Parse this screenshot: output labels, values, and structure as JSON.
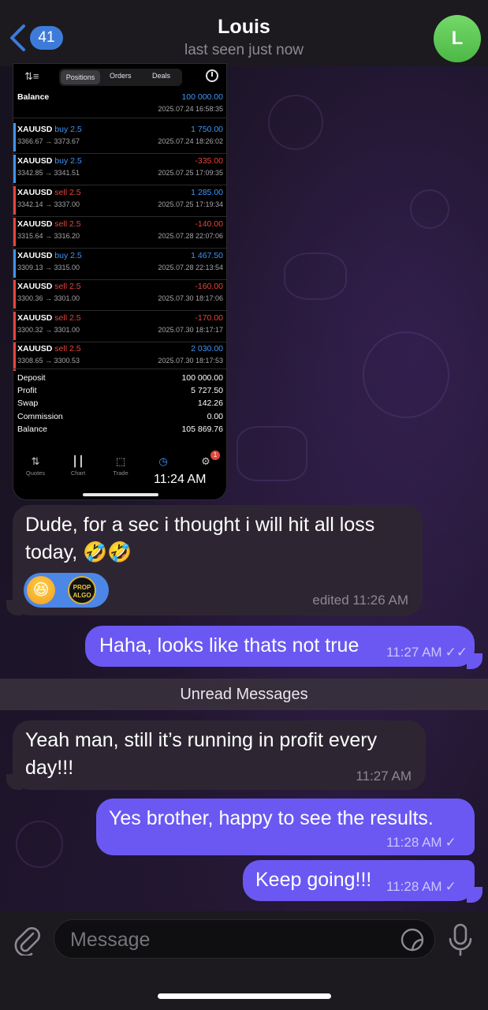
{
  "header": {
    "unread_count": "41",
    "title": "Louis",
    "status": "last seen just now",
    "avatar_letter": "L"
  },
  "photo": {
    "tabs": [
      "Positions",
      "Orders",
      "Deals"
    ],
    "balance_label": "Balance",
    "balance_value": "100 000.00",
    "balance_date": "2025.07.24 16:58:35",
    "trades": [
      {
        "symbol": "XAUUSD",
        "side": "buy 2.5",
        "prices": "3366.67 → 3373.67",
        "profit": "1 750.00",
        "date": "2025.07.24 18:26:02"
      },
      {
        "symbol": "XAUUSD",
        "side": "buy 2.5",
        "prices": "3342.85 → 3341.51",
        "profit": "-335.00",
        "date": "2025.07.25 17:09:35"
      },
      {
        "symbol": "XAUUSD",
        "side": "sell 2.5",
        "prices": "3342.14 → 3337.00",
        "profit": "1 285.00",
        "date": "2025.07.25 17:19:34"
      },
      {
        "symbol": "XAUUSD",
        "side": "sell 2.5",
        "prices": "3315.64 → 3316.20",
        "profit": "-140.00",
        "date": "2025.07.28 22:07:06"
      },
      {
        "symbol": "XAUUSD",
        "side": "buy 2.5",
        "prices": "3309.13 → 3315.00",
        "profit": "1 467.50",
        "date": "2025.07.28 22:13:54"
      },
      {
        "symbol": "XAUUSD",
        "side": "sell 2.5",
        "prices": "3300.36 → 3301.00",
        "profit": "-160.00",
        "date": "2025.07.30 18:17:06"
      },
      {
        "symbol": "XAUUSD",
        "side": "sell 2.5",
        "prices": "3300.32 → 3301.00",
        "profit": "-170.00",
        "date": "2025.07.30 18:17:17"
      },
      {
        "symbol": "XAUUSD",
        "side": "sell 2.5",
        "prices": "3308.65 → 3300.53",
        "profit": "2 030.00",
        "date": "2025.07.30 18:17:53"
      }
    ],
    "summary": [
      {
        "label": "Deposit",
        "value": "100 000.00"
      },
      {
        "label": "Profit",
        "value": "5 727.50"
      },
      {
        "label": "Swap",
        "value": "142.26"
      },
      {
        "label": "Commission",
        "value": "0.00"
      },
      {
        "label": "Balance",
        "value": "105 869.76"
      }
    ],
    "nav": [
      "Quotes",
      "Chart",
      "Trade",
      "History",
      "Settings"
    ],
    "nav_badge": "1",
    "time": "11:24 AM"
  },
  "messages": [
    {
      "dir": "in",
      "text_line1": "Dude, for a sec i thought i will hit all loss",
      "text_line2": "today, 🤣🤣",
      "meta": "edited 11:26 AM",
      "reaction_emoji": "😆",
      "reaction_avatar_text": "PROP ALGO"
    },
    {
      "dir": "out",
      "text": "Haha, looks like thats not true",
      "time": "11:27 AM"
    },
    {
      "dir": "in",
      "text_line1": "Yeah man, still it’s running in profit every",
      "text_line2": "day!!!",
      "time": "11:27 AM"
    },
    {
      "dir": "out",
      "text": "Yes brother, happy to see the results.",
      "time": "11:28 AM"
    },
    {
      "dir": "out",
      "text": "Keep going!!!",
      "time": "11:28 AM"
    }
  ],
  "unread_label": "Unread Messages",
  "input": {
    "placeholder": "Message"
  },
  "colors": {
    "outgoing": "#6b58f2",
    "incoming": "#2d2632",
    "profit_positive": "#3f95f5",
    "profit_negative": "#e8453c",
    "buy": "#3f95f5",
    "sell": "#e8453c"
  }
}
